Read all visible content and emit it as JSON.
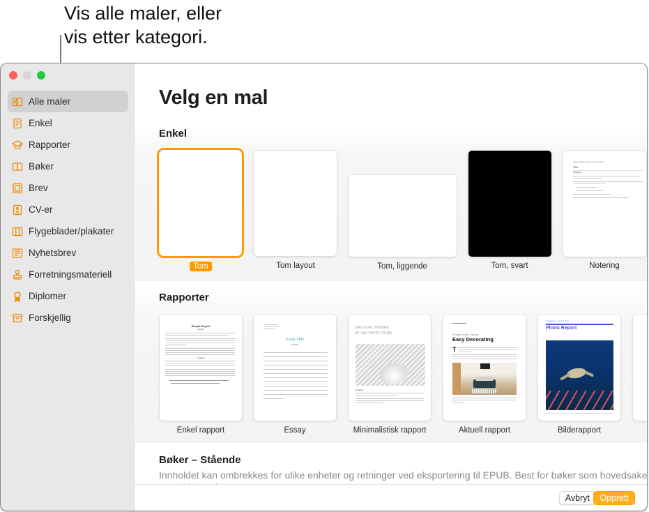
{
  "callout": {
    "line1": "Vis alle maler, eller",
    "line2": "vis etter kategori."
  },
  "window": {
    "title": "Velg en mal",
    "accent_color": "#fe9a00"
  },
  "sidebar": {
    "items": [
      {
        "label": "Alle maler",
        "icon": "grid-icon",
        "active": true
      },
      {
        "label": "Enkel",
        "icon": "document-icon"
      },
      {
        "label": "Rapporter",
        "icon": "graduation-cap-icon"
      },
      {
        "label": "Bøker",
        "icon": "book-icon"
      },
      {
        "label": "Brev",
        "icon": "letter-icon"
      },
      {
        "label": "CV-er",
        "icon": "resume-icon"
      },
      {
        "label": "Flygeblader/plakater",
        "icon": "flyer-icon"
      },
      {
        "label": "Nyhetsbrev",
        "icon": "newsletter-icon"
      },
      {
        "label": "Forretningsmateriell",
        "icon": "stamp-icon"
      },
      {
        "label": "Diplomer",
        "icon": "ribbon-icon"
      },
      {
        "label": "Forskjellig",
        "icon": "archive-box-icon"
      }
    ]
  },
  "sections": {
    "enkel": {
      "title": "Enkel",
      "templates": [
        {
          "label": "Tom",
          "selected": true
        },
        {
          "label": "Tom layout"
        },
        {
          "label": "Tom, liggende"
        },
        {
          "label": "Tom, svart"
        },
        {
          "label": "Notering",
          "preview": {
            "date": "Wednesday, December 18, 2019",
            "title": "Title",
            "subject": "Subject"
          }
        }
      ]
    },
    "rapporter": {
      "title": "Rapporter",
      "templates": [
        {
          "label": "Enkel rapport",
          "preview": {
            "title": "Simple Report",
            "subtitle": "Subtitle",
            "heading": "Heading"
          }
        },
        {
          "label": "Essay",
          "preview": {
            "title": "Essay Title",
            "subtitle": "Subtitle"
          }
        },
        {
          "label": "Minimalistisk rapport",
          "preview": {
            "title_line1": "ORGANIC FORMS",
            "title_line2": "IN ARCHITECTURE",
            "heading": "Heading"
          }
        },
        {
          "label": "Aktuell rapport",
          "preview": {
            "kicker": "Simple Home Styling",
            "title": "Easy Decorating"
          }
        },
        {
          "label": "Bilderapport",
          "preview": {
            "byline": "Author Name – April 14, 2022",
            "title": "Photo Report"
          }
        }
      ]
    },
    "boker": {
      "title": "Bøker – Stående",
      "description": "Innholdet kan ombrekkes for ulike enheter og retninger ved eksportering til EPUB. Best for bøker som hovedsakelig",
      "description_cont": "inneholder tekst."
    }
  },
  "footer": {
    "cancel_label": "Avbryt",
    "create_label": "Opprett"
  }
}
